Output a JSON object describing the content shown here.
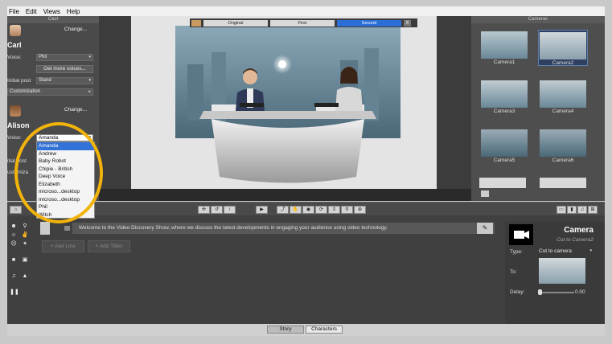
{
  "menu": [
    "File",
    "Edit",
    "Views",
    "Help"
  ],
  "cast_panel": {
    "title": "Cast",
    "characters": [
      {
        "name": "Carl",
        "change_label": "Change...",
        "voice_label": "Voice:",
        "voice_value": "Phil",
        "more_voices_label": "Get more voices...",
        "initial_post_label": "Initial post",
        "initial_post_value": "Stand",
        "customization_label": "Customization"
      },
      {
        "name": "Alison",
        "change_label": "Change...",
        "voice_label": "Voice:",
        "voice_value": "Amanda",
        "initial_post_label": "itial post",
        "customization_label": "ustomiza"
      }
    ],
    "voice_options": [
      "Amanda",
      "Andrew",
      "Baby Robot",
      "Chipie - British",
      "Deep Voice",
      "Elizabeth",
      "microso...desktop",
      "microso...desktop",
      "Phil",
      "Witch"
    ],
    "voice_selected": "Amanda"
  },
  "camera_switch": {
    "buttons": [
      "Original",
      "First",
      "Second"
    ],
    "active": "Second",
    "close": "X"
  },
  "cameras_panel": {
    "title": "Cameras",
    "items": [
      "Camera1",
      "Camera2",
      "Camera3",
      "Camera4",
      "Camera5",
      "Camera6"
    ],
    "active": "Camera2"
  },
  "story": {
    "script_text": "Welcome to the Video Discovery Show, where we discuss the latest developments in engaging your audience using video technology.",
    "add_line_label": "+ Add Line",
    "add_titles_label": "+ Add Titles"
  },
  "camera_props": {
    "title": "Camera",
    "subtitle": "Cut to Camera2",
    "type_label": "Type:",
    "type_value": "Cut to camera",
    "to_label": "To:",
    "delay_label": "Delay:",
    "delay_value": "0.00"
  },
  "bottom_tabs": [
    "Story",
    "Characters"
  ],
  "colors": {
    "highlight": "#f2b30a",
    "selection": "#3372d6",
    "active_camera_btn": "#2b6fd6"
  }
}
